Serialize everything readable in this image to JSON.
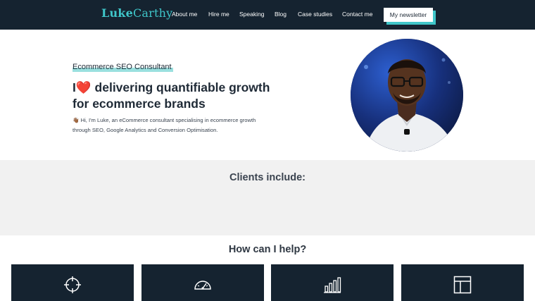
{
  "nav": {
    "logo_bold": "Luke",
    "logo_light": "Carthy",
    "links": [
      "About me",
      "Hire me",
      "Speaking",
      "Blog",
      "Case studies",
      "Contact me"
    ],
    "newsletter_label": "My newsletter"
  },
  "hero": {
    "eyebrow": "Ecommerce SEO Consultant",
    "headline_prefix": "I",
    "heart": "❤️",
    "headline_rest": " delivering quantifiable growth for ecommerce brands",
    "intro_emoji": "👋🏾",
    "intro": " Hi, I'm Luke, an eCommerce consultant specialising in ecommerce growth through SEO, Google Analytics and Conversion Optimisation."
  },
  "clients": {
    "title": "Clients include:"
  },
  "help": {
    "title": "How can I help?",
    "cards": [
      {
        "icon": "crosshair-icon"
      },
      {
        "icon": "speedometer-icon"
      },
      {
        "icon": "bar-chart-icon"
      },
      {
        "icon": "layout-icon"
      }
    ]
  },
  "colors": {
    "navy": "#152330",
    "teal": "#3fc6c9",
    "light_gray": "#f1f1f1"
  }
}
